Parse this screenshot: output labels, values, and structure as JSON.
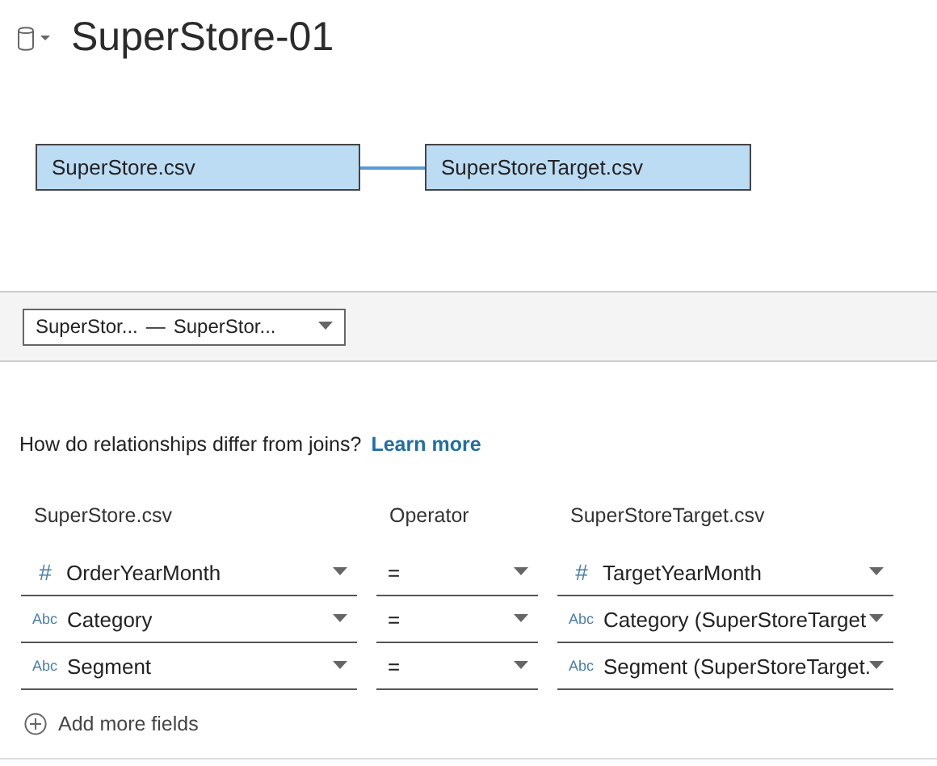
{
  "header": {
    "title": "SuperStore-01"
  },
  "canvas": {
    "tables": [
      {
        "name": "SuperStore.csv"
      },
      {
        "name": "SuperStoreTarget.csv"
      }
    ]
  },
  "relationship_picker": {
    "left": "SuperStor...",
    "separator": "—",
    "right": "SuperStor..."
  },
  "help": {
    "question": "How do relationships differ from joins?",
    "link": "Learn more"
  },
  "columns": [
    "SuperStore.csv",
    "Operator",
    "SuperStoreTarget.csv"
  ],
  "rows": [
    {
      "left": {
        "type": "#",
        "field": "OrderYearMonth"
      },
      "operator": "=",
      "right": {
        "type": "#",
        "field": "TargetYearMonth"
      }
    },
    {
      "left": {
        "type": "Abc",
        "field": "Category"
      },
      "operator": "=",
      "right": {
        "type": "Abc",
        "field": "Category (SuperStoreTarget"
      }
    },
    {
      "left": {
        "type": "Abc",
        "field": "Segment"
      },
      "operator": "=",
      "right": {
        "type": "Abc",
        "field": "Segment (SuperStoreTarget."
      }
    }
  ],
  "add_fields": "Add more fields"
}
